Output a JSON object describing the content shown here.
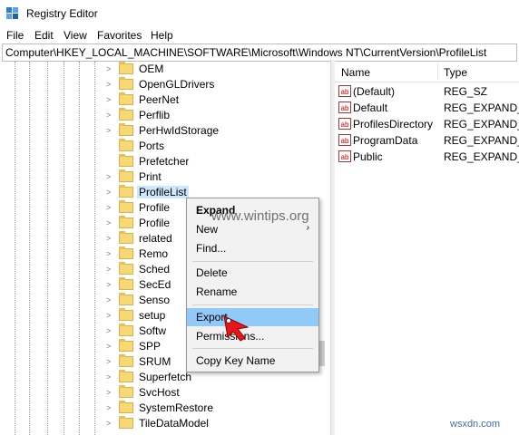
{
  "window": {
    "title": "Registry Editor"
  },
  "menubar": [
    "File",
    "Edit",
    "View",
    "Favorites",
    "Help"
  ],
  "address": "Computer\\HKEY_LOCAL_MACHINE\\SOFTWARE\\Microsoft\\Windows NT\\CurrentVersion\\ProfileList",
  "tree": {
    "items": [
      "OEM",
      "OpenGLDrivers",
      "PeerNet",
      "Perflib",
      "PerHwIdStorage",
      "Ports",
      "Prefetcher",
      "Print",
      "ProfileList",
      "Profile",
      "Profile",
      "related",
      "Remo",
      "Sched",
      "SecEd",
      "Senso",
      "setup",
      "Softw",
      "SPP",
      "SRUM",
      "Superfetch",
      "SvcHost",
      "SystemRestore",
      "TileDataModel"
    ],
    "selected": "ProfileList"
  },
  "values_pane": {
    "headers": {
      "name": "Name",
      "type": "Type"
    },
    "rows": [
      {
        "icon": "string-value-icon",
        "name": "(Default)",
        "type": "REG_SZ"
      },
      {
        "icon": "string-value-icon",
        "name": "Default",
        "type": "REG_EXPAND_SZ"
      },
      {
        "icon": "string-value-icon",
        "name": "ProfilesDirectory",
        "type": "REG_EXPAND_SZ"
      },
      {
        "icon": "string-value-icon",
        "name": "ProgramData",
        "type": "REG_EXPAND_SZ"
      },
      {
        "icon": "string-value-icon",
        "name": "Public",
        "type": "REG_EXPAND_SZ"
      }
    ]
  },
  "context_menu": {
    "expand": "Expand",
    "new": "New",
    "find": "Find...",
    "delete": "Delete",
    "rename": "Rename",
    "export": "Export",
    "permissions": "Permissions...",
    "copy_key_name": "Copy Key Name",
    "highlighted": "Export"
  },
  "watermark": "www.wintips.org",
  "corner_watermark": "wsxdn.com",
  "colors": {
    "selection": "#cce8ff",
    "menu_highlight": "#91c9f7",
    "folder": "#f8d775",
    "cursor_arrow": "#e8161b"
  }
}
